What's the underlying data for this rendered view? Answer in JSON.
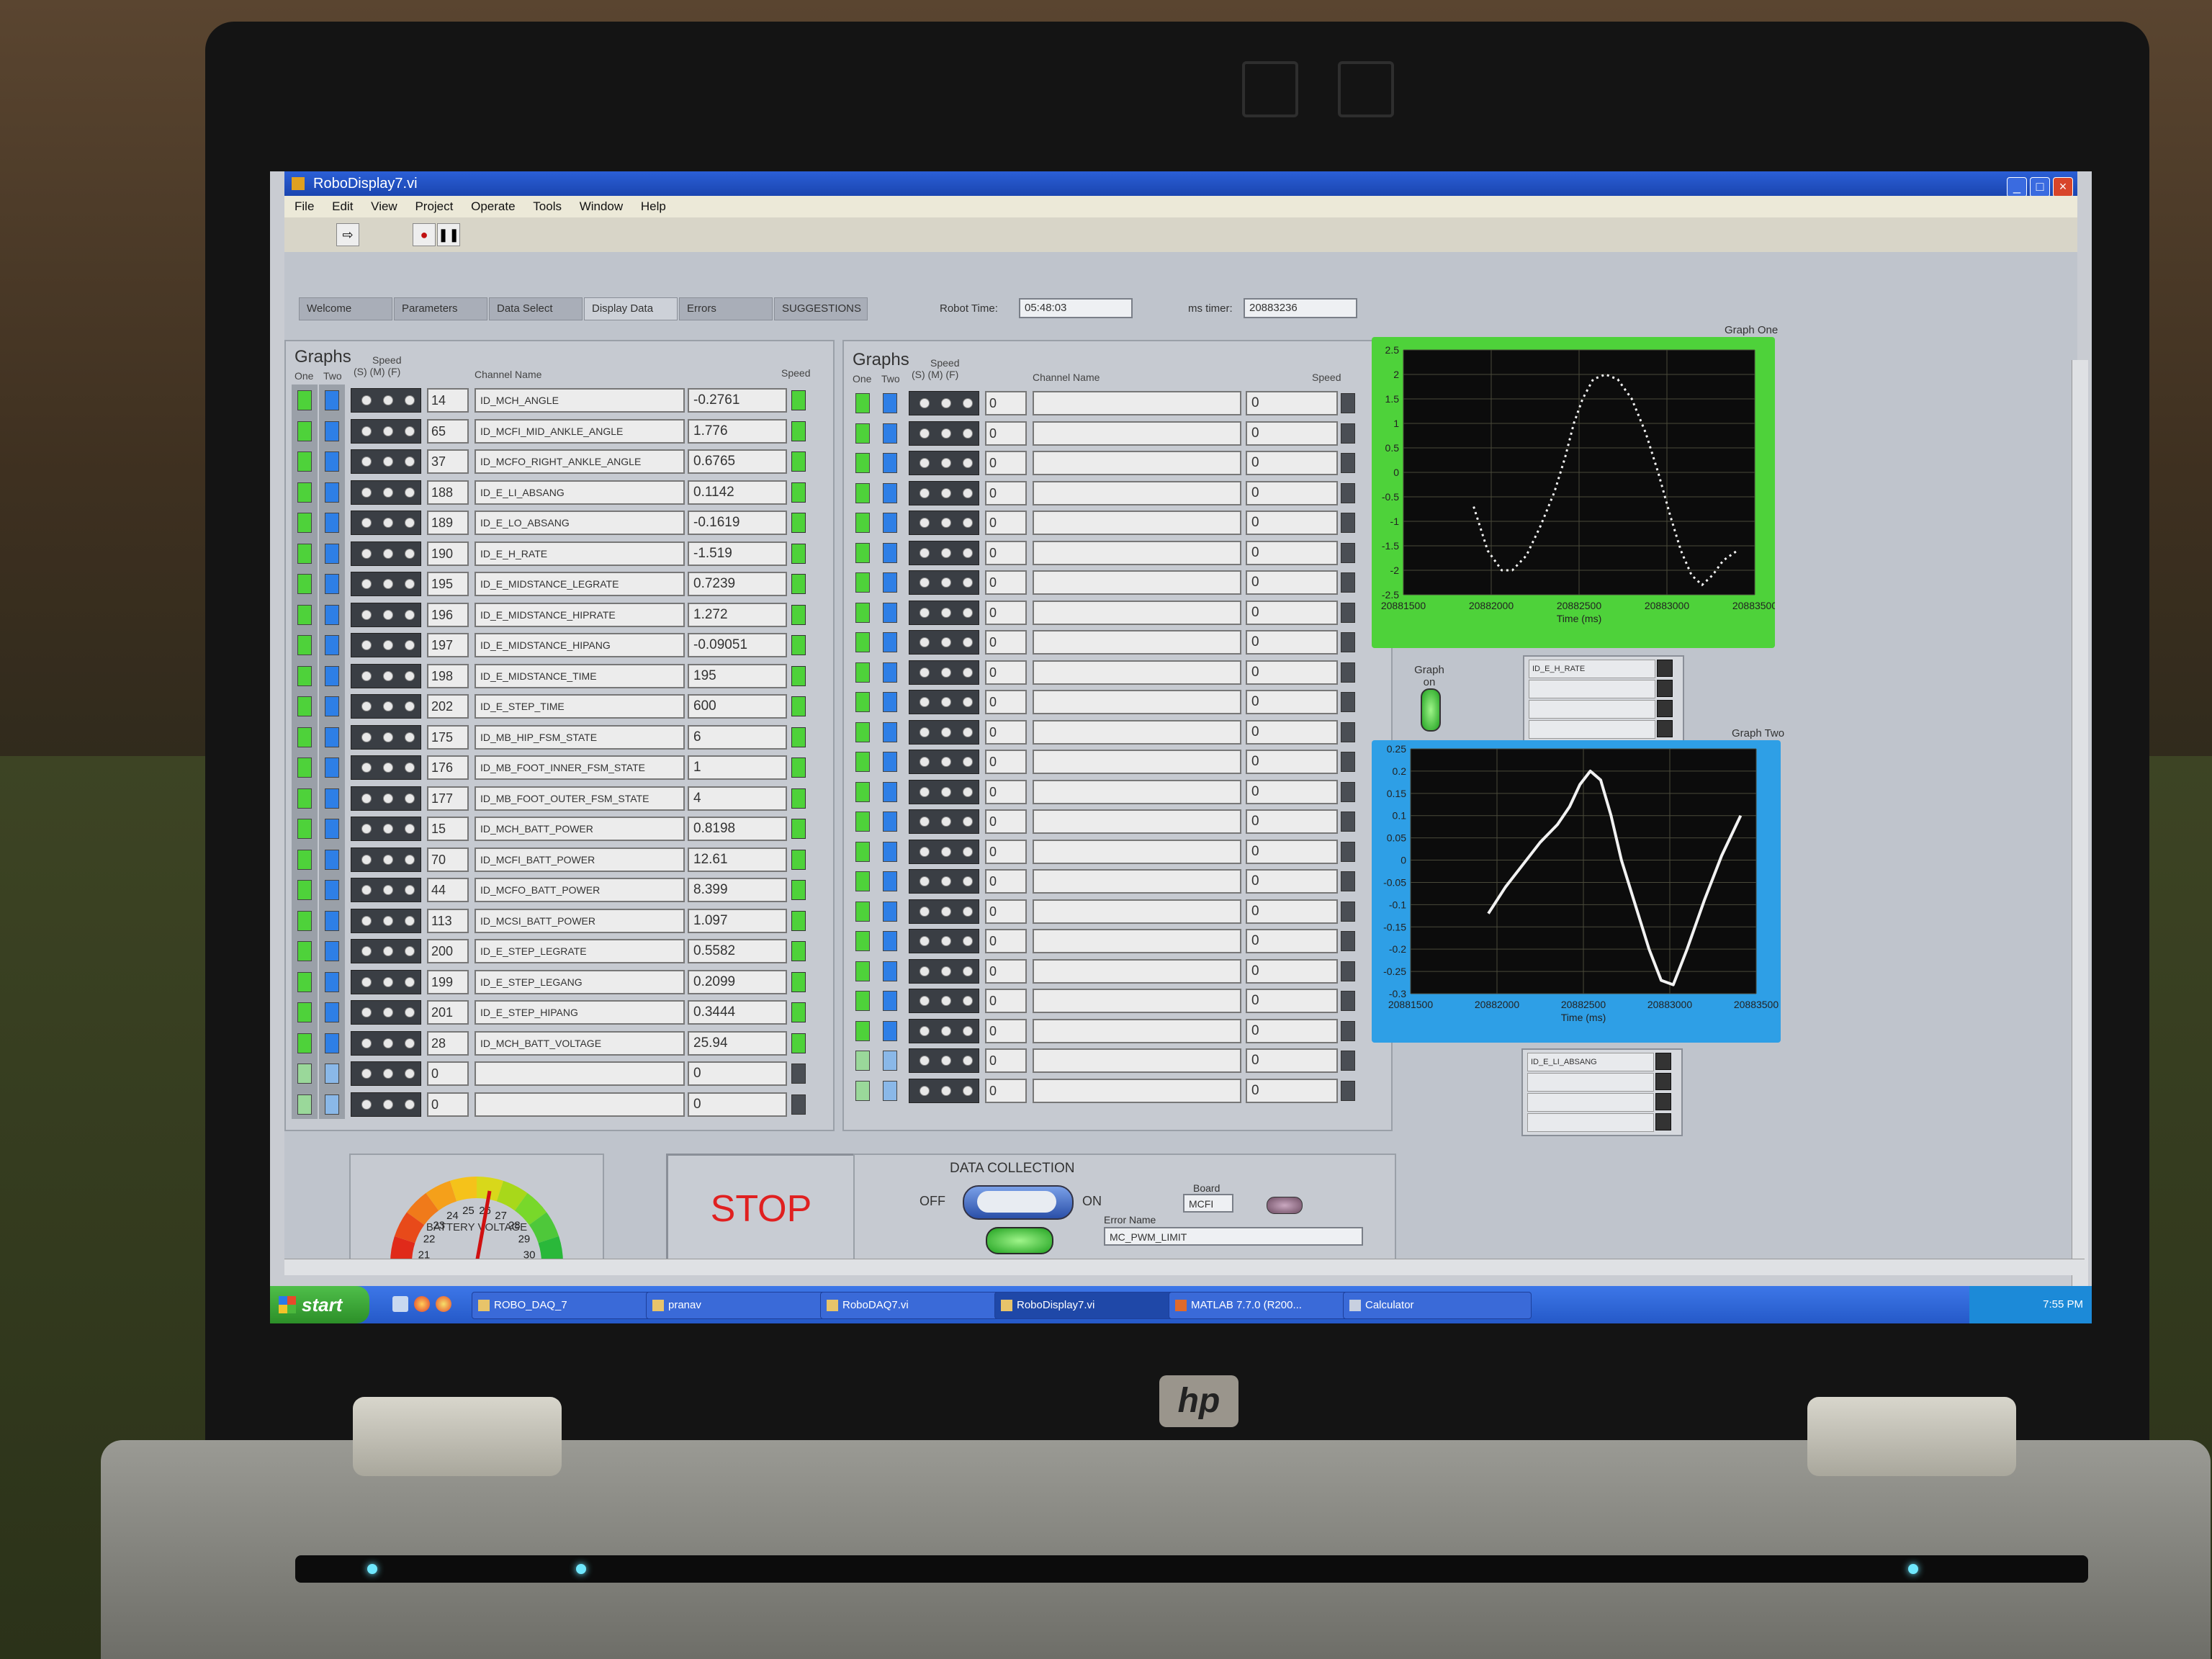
{
  "window": {
    "title": "RoboDisplay7.vi"
  },
  "menu": [
    "File",
    "Edit",
    "View",
    "Project",
    "Operate",
    "Tools",
    "Window",
    "Help"
  ],
  "tabs": [
    "Welcome",
    "Parameters",
    "Data Select",
    "Display Data",
    "Errors",
    "SUGGESTIONS"
  ],
  "robot_time": {
    "label": "Robot Time:",
    "value": "05:48:03"
  },
  "ms_timer": {
    "label": "ms timer:",
    "value": "20883236"
  },
  "left_group": {
    "title": "Graphs",
    "col_one": "One",
    "col_two": "Two",
    "col_speed": "Speed",
    "col_smf": "(S)  (M)  (F)",
    "col_channel": "Channel Name",
    "col_speed_right": "Speed",
    "rows": [
      {
        "id": "14",
        "name": "ID_MCH_ANGLE",
        "value": "-0.2761"
      },
      {
        "id": "65",
        "name": "ID_MCFI_MID_ANKLE_ANGLE",
        "value": "1.776"
      },
      {
        "id": "37",
        "name": "ID_MCFO_RIGHT_ANKLE_ANGLE",
        "value": "0.6765"
      },
      {
        "id": "188",
        "name": "ID_E_LI_ABSANG",
        "value": "0.1142"
      },
      {
        "id": "189",
        "name": "ID_E_LO_ABSANG",
        "value": "-0.1619"
      },
      {
        "id": "190",
        "name": "ID_E_H_RATE",
        "value": "-1.519"
      },
      {
        "id": "195",
        "name": "ID_E_MIDSTANCE_LEGRATE",
        "value": "0.7239"
      },
      {
        "id": "196",
        "name": "ID_E_MIDSTANCE_HIPRATE",
        "value": "1.272"
      },
      {
        "id": "197",
        "name": "ID_E_MIDSTANCE_HIPANG",
        "value": "-0.09051"
      },
      {
        "id": "198",
        "name": "ID_E_MIDSTANCE_TIME",
        "value": "195"
      },
      {
        "id": "202",
        "name": "ID_E_STEP_TIME",
        "value": "600"
      },
      {
        "id": "175",
        "name": "ID_MB_HIP_FSM_STATE",
        "value": "6"
      },
      {
        "id": "176",
        "name": "ID_MB_FOOT_INNER_FSM_STATE",
        "value": "1"
      },
      {
        "id": "177",
        "name": "ID_MB_FOOT_OUTER_FSM_STATE",
        "value": "4"
      },
      {
        "id": "15",
        "name": "ID_MCH_BATT_POWER",
        "value": "0.8198"
      },
      {
        "id": "70",
        "name": "ID_MCFI_BATT_POWER",
        "value": "12.61"
      },
      {
        "id": "44",
        "name": "ID_MCFO_BATT_POWER",
        "value": "8.399"
      },
      {
        "id": "113",
        "name": "ID_MCSI_BATT_POWER",
        "value": "1.097"
      },
      {
        "id": "200",
        "name": "ID_E_STEP_LEGRATE",
        "value": "0.5582"
      },
      {
        "id": "199",
        "name": "ID_E_STEP_LEGANG",
        "value": "0.2099"
      },
      {
        "id": "201",
        "name": "ID_E_STEP_HIPANG",
        "value": "0.3444"
      },
      {
        "id": "28",
        "name": "ID_MCH_BATT_VOLTAGE",
        "value": "25.94"
      },
      {
        "id": "0",
        "name": "",
        "value": "0"
      },
      {
        "id": "0",
        "name": "",
        "value": "0"
      }
    ]
  },
  "right_group": {
    "title": "Graphs",
    "col_one": "One",
    "col_two": "Two",
    "col_speed": "Speed",
    "col_smf": "(S)  (M)  (F)",
    "col_channel": "Channel Name",
    "col_speed_right": "Speed",
    "row_id": "0",
    "row_value": "0"
  },
  "graph_one": {
    "title": "Graph One",
    "xlabel": "Time (ms)",
    "yticks": [
      "2.5",
      "2",
      "1.5",
      "1",
      "0.5",
      "0",
      "-0.5",
      "-1",
      "-1.5",
      "-2",
      "-2.5"
    ],
    "xticks": [
      "20881500",
      "20882000",
      "20882500",
      "20883000",
      "20883500"
    ],
    "legend_item": "ID_E_H_RATE",
    "frame_color": "#4ed23a"
  },
  "graph_on": {
    "label": "Graph on"
  },
  "graph_two": {
    "title": "Graph Two",
    "xlabel": "Time (ms)",
    "yticks": [
      "0.25",
      "0.2",
      "0.15",
      "0.1",
      "0.05",
      "0",
      "-0.05",
      "-0.1",
      "-0.15",
      "-0.2",
      "-0.25",
      "-0.3"
    ],
    "xticks": [
      "20881500",
      "20882000",
      "20882500",
      "20883000",
      "20883500"
    ],
    "legend_item": "ID_E_LI_ABSANG",
    "frame_color": "#2e9fe6"
  },
  "chart_data": [
    {
      "type": "line",
      "title": "Graph One",
      "xlabel": "Time (ms)",
      "ylabel": "",
      "xlim": [
        20881500,
        20883500
      ],
      "ylim": [
        -2.5,
        2.5
      ],
      "series": [
        {
          "name": "ID_E_H_RATE",
          "style": "dotted",
          "x": [
            20881900,
            20881980,
            20882060,
            20882120,
            20882200,
            20882280,
            20882360,
            20882420,
            20882470,
            20882520,
            20882580,
            20882650,
            20882720,
            20882800,
            20882880,
            20882950,
            20883020,
            20883080,
            20883140,
            20883200,
            20883260,
            20883320,
            20883400
          ],
          "y": [
            -0.7,
            -1.6,
            -2.0,
            -2.0,
            -1.7,
            -1.1,
            -0.4,
            0.3,
            1.0,
            1.5,
            1.9,
            2.0,
            1.9,
            1.5,
            0.8,
            0.0,
            -0.9,
            -1.6,
            -2.1,
            -2.3,
            -2.1,
            -1.8,
            -1.6
          ]
        }
      ]
    },
    {
      "type": "line",
      "title": "Graph Two",
      "xlabel": "Time (ms)",
      "ylabel": "",
      "xlim": [
        20881500,
        20883500
      ],
      "ylim": [
        -0.3,
        0.25
      ],
      "series": [
        {
          "name": "ID_E_LI_ABSANG",
          "style": "solid",
          "x": [
            20881950,
            20882050,
            20882150,
            20882250,
            20882350,
            20882420,
            20882480,
            20882540,
            20882600,
            20882660,
            20882720,
            20882800,
            20882880,
            20882950,
            20883020,
            20883100,
            20883200,
            20883300,
            20883410
          ],
          "y": [
            -0.12,
            -0.06,
            -0.01,
            0.04,
            0.08,
            0.12,
            0.17,
            0.2,
            0.18,
            0.1,
            0.0,
            -0.1,
            -0.2,
            -0.27,
            -0.28,
            -0.2,
            -0.09,
            0.01,
            0.1
          ]
        }
      ]
    }
  ],
  "gauge": {
    "label": "BATTERY VOLTAGE",
    "ticks": [
      "21",
      "22",
      "23",
      "24",
      "25",
      "26",
      "27",
      "28",
      "29",
      "30"
    ]
  },
  "stop_label": "STOP",
  "data_collection": {
    "title": "DATA COLLECTION",
    "off": "OFF",
    "on": "ON"
  },
  "board": {
    "label": "Board",
    "value": "MCFI"
  },
  "error_name": {
    "label": "Error Name",
    "value": "MC_PWM_LIMIT"
  },
  "taskbar": {
    "start": "start",
    "tasks": [
      "ROBO_DAQ_7",
      "pranav",
      "RoboDAQ7.vi",
      "RoboDisplay7.vi",
      "MATLAB 7.7.0 (R200...",
      "Calculator"
    ],
    "clock": "7:55 PM"
  },
  "laptop_brand": "hp"
}
